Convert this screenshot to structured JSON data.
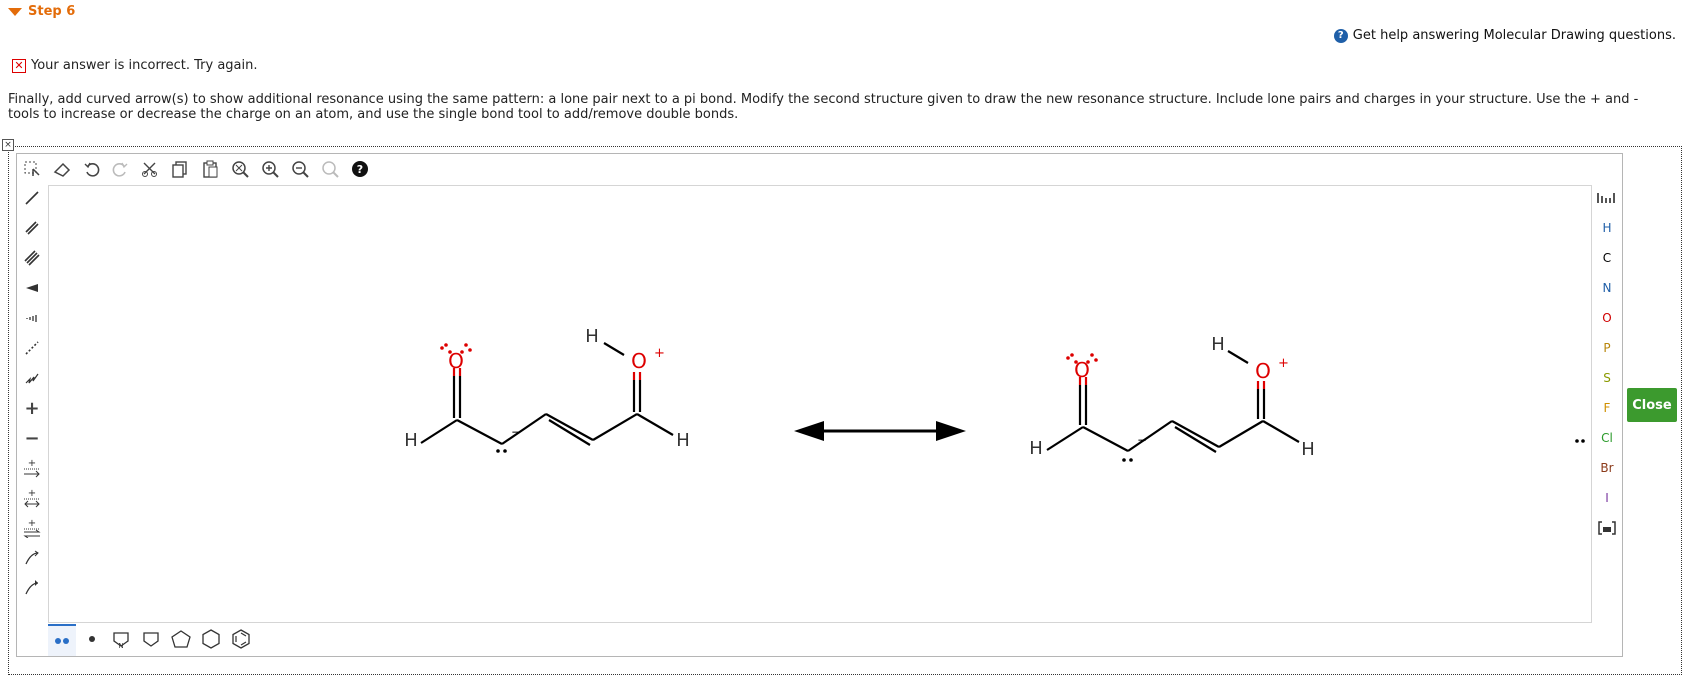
{
  "step": {
    "label": "Step 6"
  },
  "help": {
    "text": "Get help answering Molecular Drawing questions."
  },
  "feedback": {
    "text": "Your answer is incorrect.  Try again."
  },
  "instructions": {
    "text": "Finally, add curved arrow(s) to show additional resonance using the same pattern: a lone pair next to a pi bond. Modify the second structure given to draw the new resonance structure. Include lone pairs and charges in your structure. Use the + and - tools to increase or decrease the charge on an atom, and use the single bond tool to add/remove double bonds."
  },
  "close_label": "Close",
  "top_toolbar": [
    "select-tool",
    "eraser-tool",
    "undo",
    "redo",
    "cut",
    "copy",
    "paste",
    "zoom-fit",
    "zoom-in",
    "zoom-out",
    "zoom-reset",
    "help"
  ],
  "left_toolbar": [
    "single-bond",
    "double-bond",
    "triple-bond",
    "wedge-bond",
    "hash-bond",
    "dashed-bond",
    "wavy-bond",
    "increase-charge",
    "decrease-charge",
    "arrow",
    "resonance-arrow",
    "equilibrium-arrow",
    "curved-arrow-single",
    "curved-arrow-double"
  ],
  "elements": [
    {
      "symbol": "H",
      "color": "#1f5fa8"
    },
    {
      "symbol": "C",
      "color": "#000000"
    },
    {
      "symbol": "N",
      "color": "#1f5fa8"
    },
    {
      "symbol": "O",
      "color": "#d00000"
    },
    {
      "symbol": "P",
      "color": "#b8860b"
    },
    {
      "symbol": "S",
      "color": "#8a9a00"
    },
    {
      "symbol": "F",
      "color": "#d09000"
    },
    {
      "symbol": "Cl",
      "color": "#2a9a2a"
    },
    {
      "symbol": "Br",
      "color": "#8b3a1a"
    },
    {
      "symbol": "I",
      "color": "#7a3aa0"
    }
  ],
  "molecule": {
    "left_labels": {
      "o1": "O",
      "o2": "O",
      "h1": "H",
      "h2": "H",
      "h3": "H",
      "charge": "+",
      "neg": "−"
    },
    "right_labels": {
      "o1": "O",
      "o2": "O",
      "h1": "H",
      "h2": "H",
      "h3": "H",
      "charge": "+",
      "neg": "−"
    }
  }
}
